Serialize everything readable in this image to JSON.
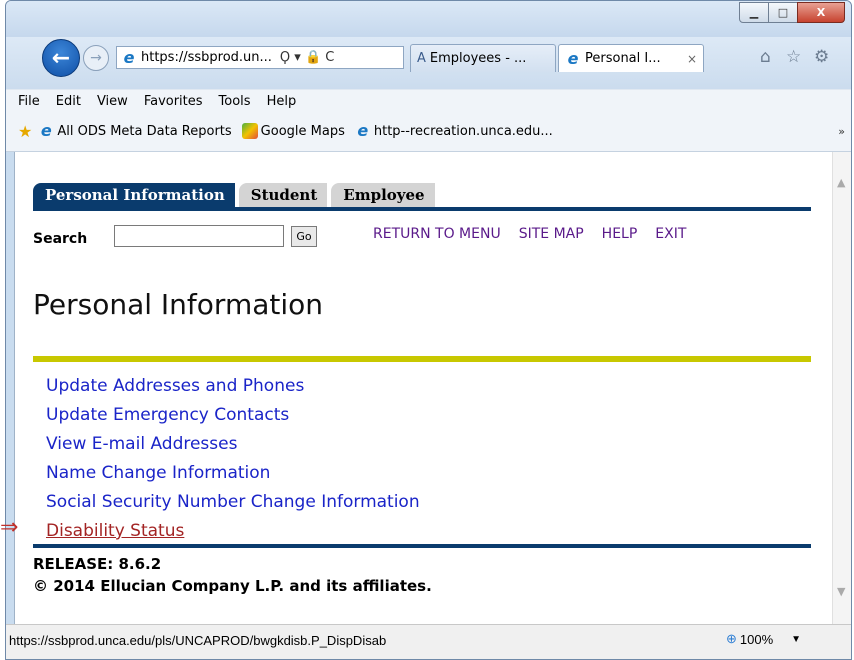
{
  "browser": {
    "window_buttons": {
      "minimize": "▁",
      "maximize": "□",
      "close": "X"
    },
    "address_url": "https://ssbprod.un...",
    "address_tools": "Ϙ ▾ 🔒 C",
    "tabs": [
      {
        "label": "Employees - ..."
      },
      {
        "label": "Personal I...",
        "close": "×"
      }
    ],
    "right_icons": [
      "⌂",
      "☆",
      "⚙"
    ],
    "menu": [
      "File",
      "Edit",
      "View",
      "Favorites",
      "Tools",
      "Help"
    ],
    "favorites": [
      {
        "label": "All ODS Meta Data Reports"
      },
      {
        "label": "Google Maps"
      },
      {
        "label": "http--recreation.unca.edu..."
      }
    ],
    "favbar_chevron": "»",
    "status_url": "https://ssbprod.unca.edu/pls/UNCAPROD/bwgkdisb.P_DispDisab",
    "zoom": "100%"
  },
  "page": {
    "tabs": [
      "Personal Information",
      "Student",
      "Employee"
    ],
    "search_label": "Search",
    "search_value": "",
    "go_label": "Go",
    "top_links": [
      "RETURN TO MENU",
      "SITE MAP",
      "HELP",
      "EXIT"
    ],
    "title": "Personal Information",
    "links": [
      "Update Addresses and Phones",
      "Update Emergency Contacts",
      "View E-mail Addresses",
      "Name Change Information",
      "Social Security Number Change Information",
      "Disability Status"
    ],
    "release": "RELEASE: 8.6.2",
    "copyright": "© 2014 Ellucian Company L.P. and its affiliates."
  },
  "colors": {
    "tab_active": "#0a3b6d",
    "rule_yellow": "#c8c800",
    "link": "#1a24c8",
    "visited_link": "#a32424",
    "toplinks": "#5a1a8a",
    "annotation_arrow": "#c0302a"
  }
}
